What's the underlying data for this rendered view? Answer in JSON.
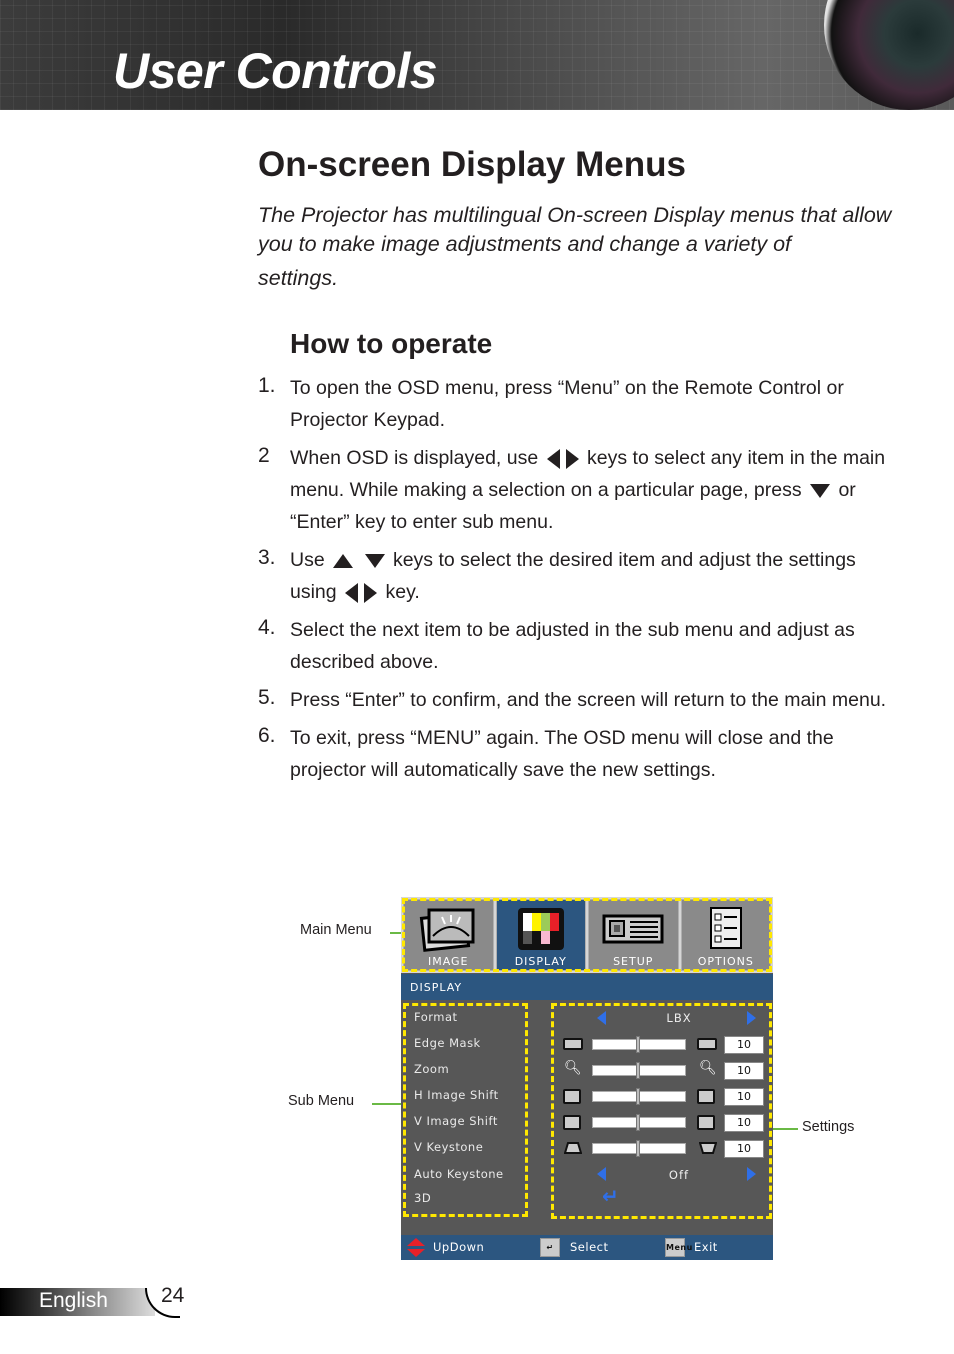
{
  "header": {
    "title": "User Controls"
  },
  "page_title": "On-screen Display Menus",
  "intro": {
    "line1": "The Projector has multilingual On-screen Display menus that allow you to make image adjustments and change a variety of",
    "line2": "settings."
  },
  "section_title": "How to operate",
  "steps": [
    {
      "num": "1.",
      "text": "To open the OSD menu, press “Menu” on the Remote Control or Projector Keypad."
    },
    {
      "num": "2",
      "text_a": "When OSD is displayed, use",
      "text_b": "keys to select any item in the main menu. While making a selection on a particular page, press",
      "text_c": "or “Enter” key to enter sub menu."
    },
    {
      "num": "3.",
      "text_a": "Use",
      "text_b": "keys to select the desired item and adjust the settings using",
      "text_c": "key."
    },
    {
      "num": "4.",
      "text": "Select the next item to be adjusted in the sub menu and adjust as described above."
    },
    {
      "num": "5.",
      "text": "Press “Enter” to confirm, and the screen will return to the main menu."
    },
    {
      "num": "6.",
      "text": "To exit, press “MENU” again. The OSD menu will close and the projector will automatically save the new settings."
    }
  ],
  "osd": {
    "tabs": [
      {
        "label": "IMAGE",
        "icon": "image-icon",
        "active": false
      },
      {
        "label": "DISPLAY",
        "icon": "display-icon",
        "active": true
      },
      {
        "label": "SETUP",
        "icon": "projector-icon",
        "active": false
      },
      {
        "label": "OPTIONS",
        "icon": "checklist-icon",
        "active": false
      }
    ],
    "section_bar": "DISPLAY",
    "sub_items": [
      "Format",
      "Edge Mask",
      "Zoom",
      "H Image Shift",
      "V Image Shift",
      "V Keystone",
      "Auto Keystone",
      "3D"
    ],
    "settings": {
      "format_value": "LBX",
      "edge_mask": {
        "value": "10",
        "level": 0.5
      },
      "zoom": {
        "value": "10",
        "level": 0.5
      },
      "h_image_shift": {
        "value": "10",
        "level": 0.5
      },
      "v_image_shift": {
        "value": "10",
        "level": 0.5
      },
      "v_keystone": {
        "value": "10",
        "level": 0.5
      },
      "auto_keystone_value": "Off",
      "three_d": "enter-icon"
    },
    "footer": {
      "updown": "UpDown",
      "select": "Select",
      "menu_key": "Menu",
      "exit": "Exit"
    },
    "colors": {
      "highlight": "#2c5680",
      "dash": "#ffe800",
      "arrow": "#2f6fe8",
      "callout": "#6ab945"
    }
  },
  "callouts": {
    "main_menu": "Main Menu",
    "sub_menu": "Sub Menu",
    "settings": "Settings"
  },
  "footer": {
    "language": "English",
    "page": "24"
  }
}
